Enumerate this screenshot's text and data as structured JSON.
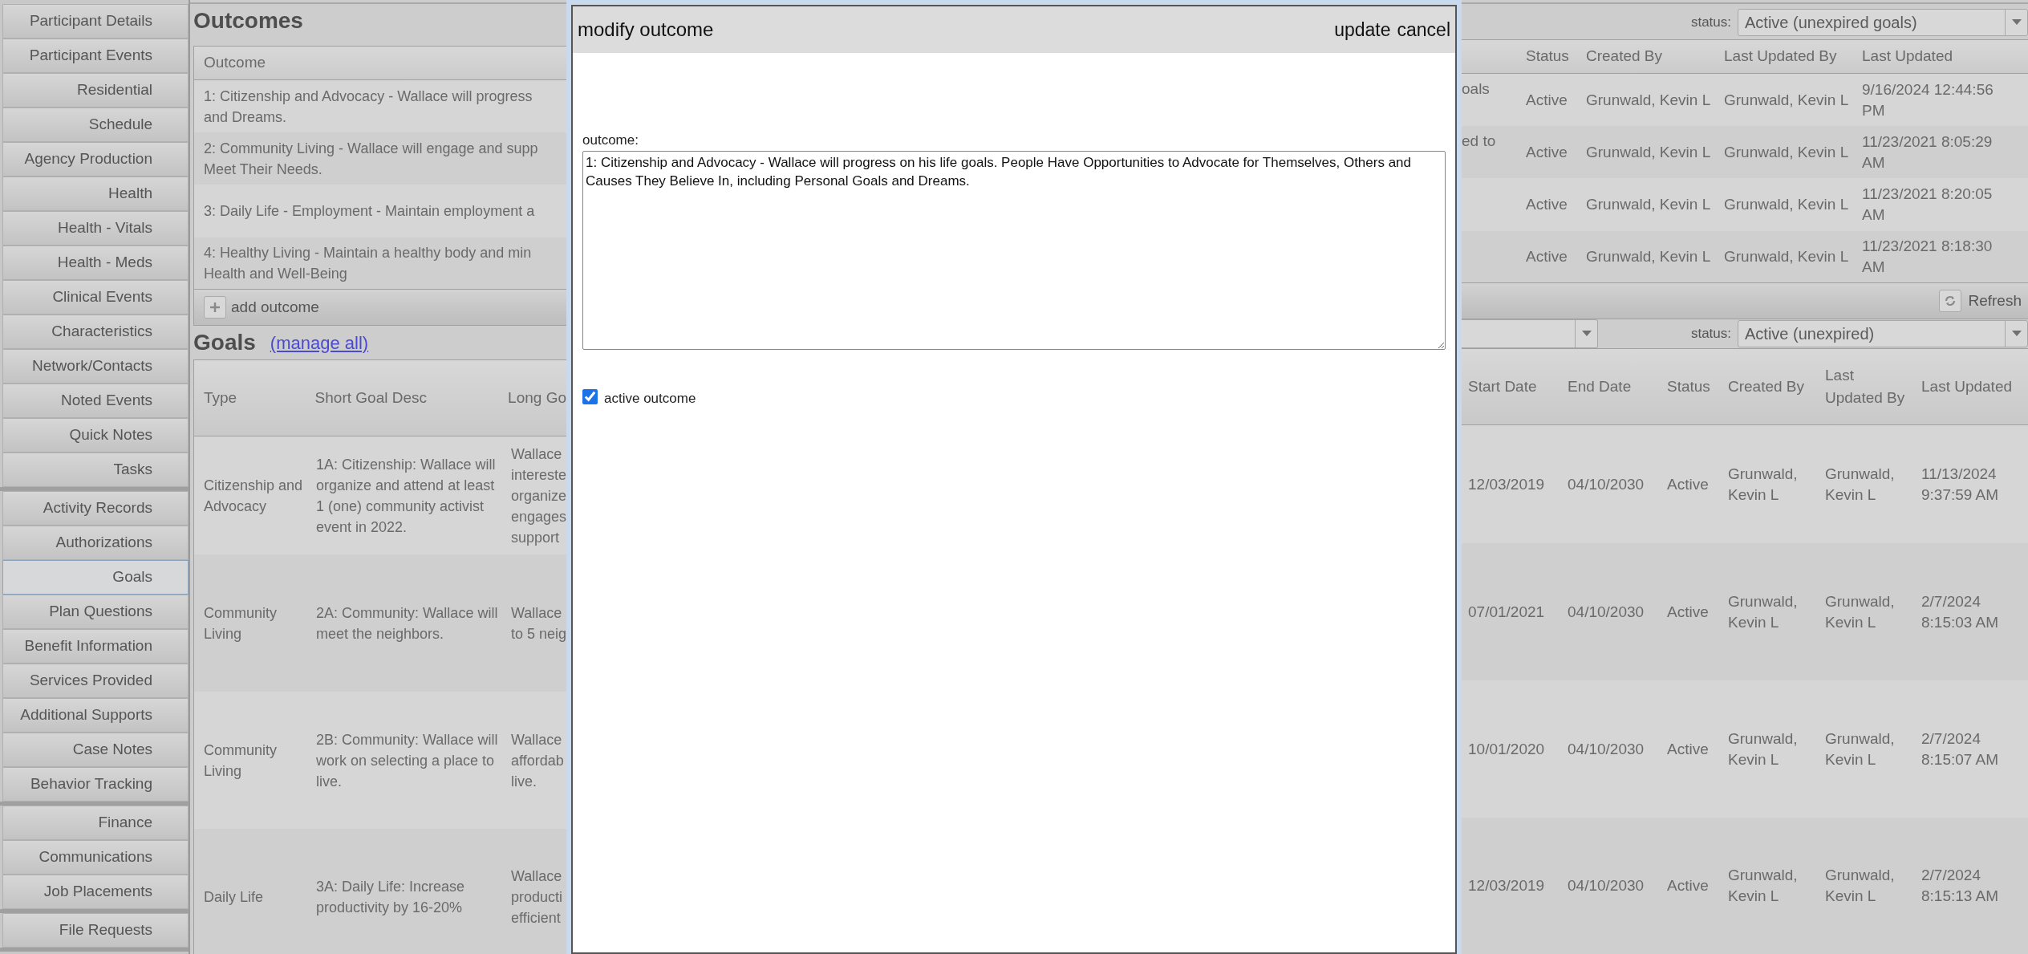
{
  "sidebar": {
    "groups": [
      {
        "items": [
          {
            "label": "Participant Details",
            "selected": false
          },
          {
            "label": "Participant Events",
            "selected": false
          },
          {
            "label": "Residential",
            "selected": false
          },
          {
            "label": "Schedule",
            "selected": false
          },
          {
            "label": "Agency Production",
            "selected": false
          },
          {
            "label": "Health",
            "selected": false
          },
          {
            "label": "Health - Vitals",
            "selected": false
          },
          {
            "label": "Health - Meds",
            "selected": false
          },
          {
            "label": "Clinical Events",
            "selected": false
          },
          {
            "label": "Characteristics",
            "selected": false
          },
          {
            "label": "Network/Contacts",
            "selected": false
          },
          {
            "label": "Noted Events",
            "selected": false
          },
          {
            "label": "Quick Notes",
            "selected": false
          },
          {
            "label": "Tasks",
            "selected": false
          }
        ]
      },
      {
        "items": [
          {
            "label": "Activity Records",
            "selected": false
          },
          {
            "label": "Authorizations",
            "selected": false
          },
          {
            "label": "Goals",
            "selected": true
          },
          {
            "label": "Plan Questions",
            "selected": false
          },
          {
            "label": "Benefit Information",
            "selected": false
          },
          {
            "label": "Services Provided",
            "selected": false
          },
          {
            "label": "Additional Supports",
            "selected": false
          },
          {
            "label": "Case Notes",
            "selected": false
          },
          {
            "label": "Behavior Tracking",
            "selected": false
          }
        ]
      },
      {
        "items": [
          {
            "label": "Finance",
            "selected": false
          },
          {
            "label": "Communications",
            "selected": false
          },
          {
            "label": "Job Placements",
            "selected": false
          }
        ]
      },
      {
        "items": [
          {
            "label": "File Requests",
            "selected": false
          }
        ]
      }
    ]
  },
  "outcomes": {
    "title": "Outcomes",
    "status_label": "status:",
    "status_value": "Active (unexpired goals)",
    "column_left": "Outcome",
    "columns_right": [
      "Status",
      "Created By",
      "Last Updated By",
      "Last Updated"
    ],
    "rows": [
      {
        "outcome": [
          "1: Citizenship and Advocacy - Wallace will progress",
          "and Dreams."
        ],
        "column_2": "oals",
        "status": "Active",
        "created_by": "Grunwald, Kevin L",
        "updated_by": "Grunwald, Kevin L",
        "updated": "9/16/2024 12:44:56 PM"
      },
      {
        "outcome": [
          "2: Community Living - Wallace will engage and supp",
          "Meet Their Needs."
        ],
        "column_2": "ed to",
        "status": "Active",
        "created_by": "Grunwald, Kevin L",
        "updated_by": "Grunwald, Kevin L",
        "updated": "11/23/2021 8:05:29 AM"
      },
      {
        "outcome": [
          "3: Daily Life - Employment - Maintain employment a"
        ],
        "column_2": "",
        "status": "Active",
        "created_by": "Grunwald, Kevin L",
        "updated_by": "Grunwald, Kevin L",
        "updated": "11/23/2021 8:20:05 AM"
      },
      {
        "outcome": [
          "4: Healthy Living - Maintain a healthy body and min",
          "Health and Well-Being"
        ],
        "column_2": "",
        "status": "Active",
        "created_by": "Grunwald, Kevin L",
        "updated_by": "Grunwald, Kevin L",
        "updated": "11/23/2021 8:18:30 AM"
      }
    ],
    "add_label": "add outcome",
    "refresh_label": "Refresh"
  },
  "goals": {
    "title": "Goals",
    "manage_link": "(manage all)",
    "status_label": "status:",
    "status_value": "Active (unexpired)",
    "columns_left": [
      "Type",
      "Short Goal Desc",
      "Long Go"
    ],
    "columns_right": [
      "Start Date",
      "End Date",
      "Status",
      "Created By",
      "Last Updated By",
      "Last Updated"
    ],
    "rows": [
      {
        "type": "Citizenship and Advocacy",
        "short": "1A: Citizenship: Wallace will organize and attend at least 1 (one) community activist event in 2022.",
        "long": [
          "Wallace",
          "intereste",
          "organize",
          "engages",
          "support"
        ],
        "start": "12/03/2019",
        "end": "04/10/2030",
        "status": "Active",
        "created_by": "Grunwald, Kevin L",
        "updated_by": "Grunwald, Kevin L",
        "updated": "11/13/2024 9:37:59 AM"
      },
      {
        "type": "Community Living",
        "short": "2A: Community: Wallace will meet the neighbors.",
        "long": [
          "Wallace",
          "to 5 neig"
        ],
        "start": "07/01/2021",
        "end": "04/10/2030",
        "status": "Active",
        "created_by": "Grunwald, Kevin L",
        "updated_by": "Grunwald, Kevin L",
        "updated": "2/7/2024 8:15:03 AM"
      },
      {
        "type": "Community Living",
        "short": "2B: Community: Wallace will work on selecting a place to live.",
        "long": [
          "Wallace",
          "affordab",
          "live."
        ],
        "start": "10/01/2020",
        "end": "04/10/2030",
        "status": "Active",
        "created_by": "Grunwald, Kevin L",
        "updated_by": "Grunwald, Kevin L",
        "updated": "2/7/2024 8:15:07 AM"
      },
      {
        "type": "Daily Life",
        "short": "3A: Daily Life: Increase productivity by 16-20%",
        "long": [
          "Wallace",
          "producti",
          "efficient"
        ],
        "start": "12/03/2019",
        "end": "04/10/2030",
        "status": "Active",
        "created_by": "Grunwald, Kevin L",
        "updated_by": "Grunwald, Kevin L",
        "updated": "2/7/2024 8:15:13 AM"
      }
    ]
  },
  "modal": {
    "title": "modify outcome",
    "actions": [
      "update",
      "cancel"
    ],
    "field_label": "outcome:",
    "value": "1: Citizenship and Advocacy - Wallace will progress on his life goals. People Have Opportunities to Advocate for Themselves, Others and Causes They Believe In, including Personal Goals and Dreams.",
    "checkbox": {
      "label": "active outcome",
      "checked": true
    }
  }
}
